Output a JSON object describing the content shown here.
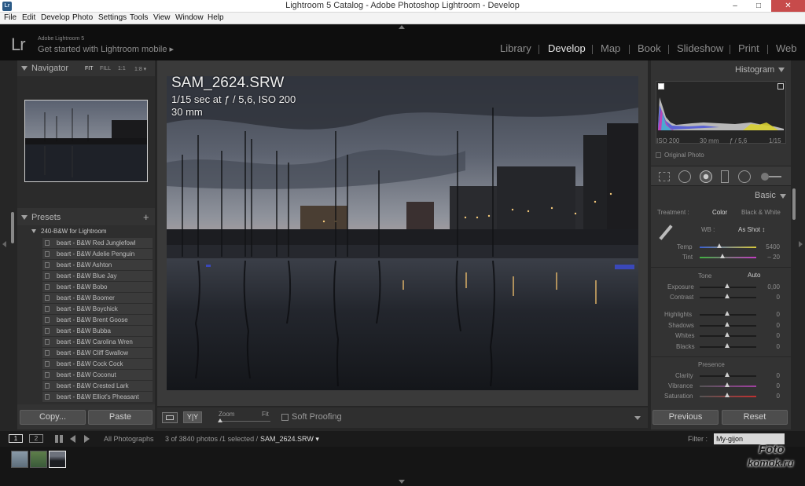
{
  "window": {
    "title": "Lightroom 5 Catalog - Adobe Photoshop Lightroom - Develop",
    "minimize": "–",
    "maximize": "□",
    "close": "✕",
    "app_icon": "Lr"
  },
  "menu": [
    "File",
    "Edit",
    "Develop",
    "Photo",
    "Settings",
    "Tools",
    "View",
    "Window",
    "Help"
  ],
  "identity": {
    "logo": "Lr",
    "version": "Adobe Lightroom 5",
    "mobile_prompt": "Get started with Lightroom mobile ▸"
  },
  "modules": [
    "Library",
    "Develop",
    "Map",
    "Book",
    "Slideshow",
    "Print",
    "Web"
  ],
  "active_module": "Develop",
  "navigator": {
    "title": "Navigator",
    "options": [
      "FIT",
      "FILL",
      "1:1",
      "1:8 ▾"
    ]
  },
  "presets": {
    "title": "Presets",
    "add": "+",
    "folder": "240-B&W for Lightroom",
    "items": [
      "beart - B&W Red Junglefowl",
      "beart - B&W Adelie Penguin",
      "beart - B&W Ashton",
      "beart - B&W Blue Jay",
      "beart - B&W Bobo",
      "beart - B&W Boomer",
      "beart - B&W Boychick",
      "beart - B&W Brent Goose",
      "beart - B&W Bubba",
      "beart - B&W Carolina Wren",
      "beart - B&W Cliff Swallow",
      "beart - B&W Cock Cock",
      "beart - B&W Coconut",
      "beart - B&W Crested Lark",
      "beart - B&W Elliot's Pheasant"
    ]
  },
  "left_buttons": {
    "copy": "Copy...",
    "paste": "Paste"
  },
  "photo_info": {
    "filename": "SAM_2624.SRW",
    "exposure": "1/15 sec at ƒ / 5,6, ISO 200",
    "focal": "30 mm"
  },
  "toolbar": {
    "zoom": "Zoom",
    "fit": "Fit",
    "soft_proofing": "Soft Proofing",
    "yy": "Y|Y"
  },
  "histogram": {
    "title": "Histogram",
    "iso": "ISO 200",
    "focal": "30 mm",
    "aperture": "ƒ / 5,6",
    "shutter": "1/15",
    "original": "Original Photo"
  },
  "basic": {
    "title": "Basic",
    "treatment_label": "Treatment :",
    "treatment_color": "Color",
    "treatment_bw": "Black & White",
    "wb_label": "WB :",
    "wb_value": "As Shot ↕",
    "temp_label": "Temp",
    "temp_value": "5400",
    "tint_label": "Tint",
    "tint_value": "– 20",
    "tone_label": "Tone",
    "auto": "Auto",
    "exposure_label": "Exposure",
    "exposure_value": "0,00",
    "contrast_label": "Contrast",
    "contrast_value": "0",
    "highlights_label": "Highlights",
    "highlights_value": "0",
    "shadows_label": "Shadows",
    "shadows_value": "0",
    "whites_label": "Whites",
    "whites_value": "0",
    "blacks_label": "Blacks",
    "blacks_value": "0",
    "presence_label": "Presence",
    "clarity_label": "Clarity",
    "clarity_value": "0",
    "vibrance_label": "Vibrance",
    "vibrance_value": "0",
    "saturation_label": "Saturation",
    "saturation_value": "0"
  },
  "right_buttons": {
    "previous": "Previous",
    "reset": "Reset"
  },
  "filmbar": {
    "screen1": "1",
    "screen2": "2",
    "source": "All Photographs",
    "count": "3 of 3840 photos /1 selected /",
    "file": "SAM_2624.SRW ▾",
    "filter_label": "Filter :",
    "filter_value": "My-gijon"
  },
  "watermark": {
    "line1": "Foto",
    "line2": "komok.ru"
  },
  "colors": {
    "accent": "#e8e8e8",
    "panel": "#333333",
    "background": "#262626"
  }
}
